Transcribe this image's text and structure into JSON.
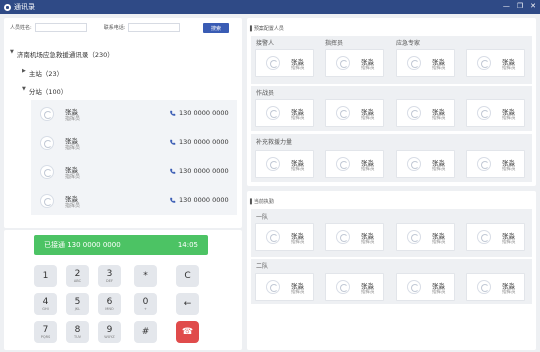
{
  "window": {
    "title": "通讯录"
  },
  "search": {
    "name_label": "人员姓名:",
    "phone_label": "联系电话:",
    "name_value": "",
    "phone_value": "",
    "button": "搜索"
  },
  "tree": {
    "root": "济南机场应急救援通讯录（230）",
    "main": "主站（23）",
    "sub": "分站（100）"
  },
  "contacts": [
    {
      "name": "张淼",
      "role": "指挥员",
      "phone": "130 0000 0000"
    },
    {
      "name": "张淼",
      "role": "指挥员",
      "phone": "130 0000 0000"
    },
    {
      "name": "张淼",
      "role": "指挥员",
      "phone": "130 0000 0000"
    },
    {
      "name": "张淼",
      "role": "指挥员",
      "phone": "130 0000 0000"
    }
  ],
  "call": {
    "status": "已接通 130 0000 0000",
    "time": "14:05"
  },
  "keypad": [
    {
      "main": "1",
      "sub": ""
    },
    {
      "main": "2",
      "sub": "ABC"
    },
    {
      "main": "3",
      "sub": "DEF"
    },
    {
      "main": "*",
      "sub": ""
    },
    {
      "main": "C",
      "sub": ""
    },
    {
      "main": "4",
      "sub": "GHI"
    },
    {
      "main": "5",
      "sub": "JKL"
    },
    {
      "main": "6",
      "sub": "MNO"
    },
    {
      "main": "0",
      "sub": "+"
    },
    {
      "main": "←",
      "sub": ""
    },
    {
      "main": "7",
      "sub": "PQRS"
    },
    {
      "main": "8",
      "sub": "TUV"
    },
    {
      "main": "9",
      "sub": "WXYZ"
    },
    {
      "main": "#",
      "sub": ""
    },
    {
      "main": "☎",
      "sub": ""
    }
  ],
  "preset": {
    "title": "预案配置人员",
    "groups": [
      {
        "label": "",
        "columns": [
          "接警人",
          "指挥员",
          "应急专家"
        ]
      },
      {
        "label": "作战员",
        "columns": []
      },
      {
        "label": "补充救援力量",
        "columns": []
      }
    ],
    "card": {
      "name": "张淼",
      "role": "指挥员"
    }
  },
  "current": {
    "title": "当前执勤",
    "groups": [
      {
        "label": "一队"
      },
      {
        "label": "二队"
      }
    ],
    "card": {
      "name": "张淼",
      "role": "指挥员"
    }
  },
  "colors": {
    "titlebar": "#2f4a86",
    "accent": "#3a5cb4",
    "call_green": "#4cc364",
    "hangup_red": "#e04b4b"
  }
}
